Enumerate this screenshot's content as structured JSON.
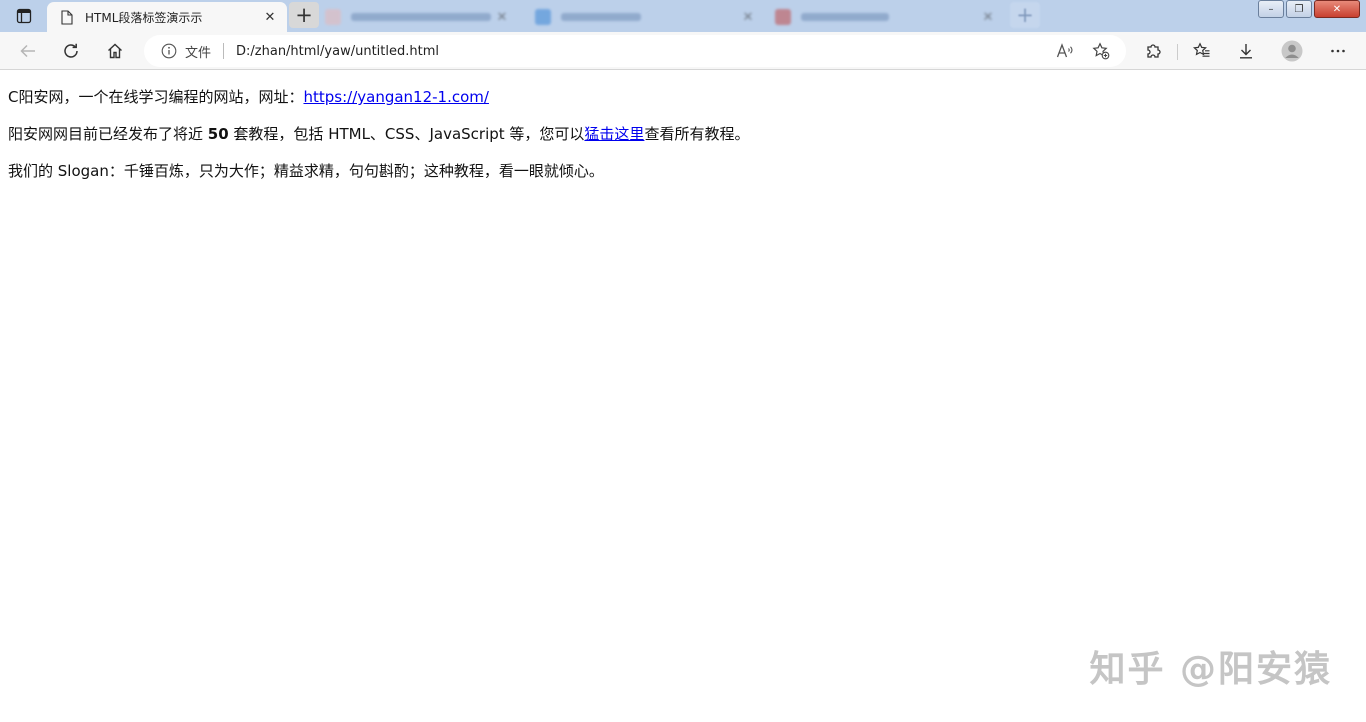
{
  "tabs": {
    "active_title": "HTML段落标签演示示",
    "new_tab_symbol": "+",
    "close_symbol": "✕",
    "inactive": [
      {
        "favicon_color": "#e7b7b7"
      },
      {
        "favicon_color": "#3b86d6"
      },
      {
        "favicon_color": "#c04a4a"
      }
    ]
  },
  "window": {
    "minimize": "–",
    "restore": "❐",
    "close": "✕"
  },
  "toolbar": {
    "address_label": "文件",
    "url": "D:/zhan/html/yaw/untitled.html"
  },
  "page": {
    "p1_prefix": "C阳安网，一个在线学习编程的网站，网址：",
    "p1_link": "https://yangan12-1.com/",
    "p2_prefix": "阳安网网目前已经发布了将近 ",
    "p2_bold": "50",
    "p2_middle": " 套教程，包括 HTML、CSS、JavaScript 等，您可以",
    "p2_link": "猛击这里",
    "p2_suffix": "查看所有教程。",
    "p3": "我们的 Slogan：千锤百炼，只为大作；精益求精，句句斟酌；这种教程，看一眼就倾心。"
  },
  "watermark": "知乎 @阳安猿",
  "colors": {
    "tabstrip": "#bcd0ea",
    "toolbar": "#f7f7f7",
    "link": "#0000ee"
  }
}
